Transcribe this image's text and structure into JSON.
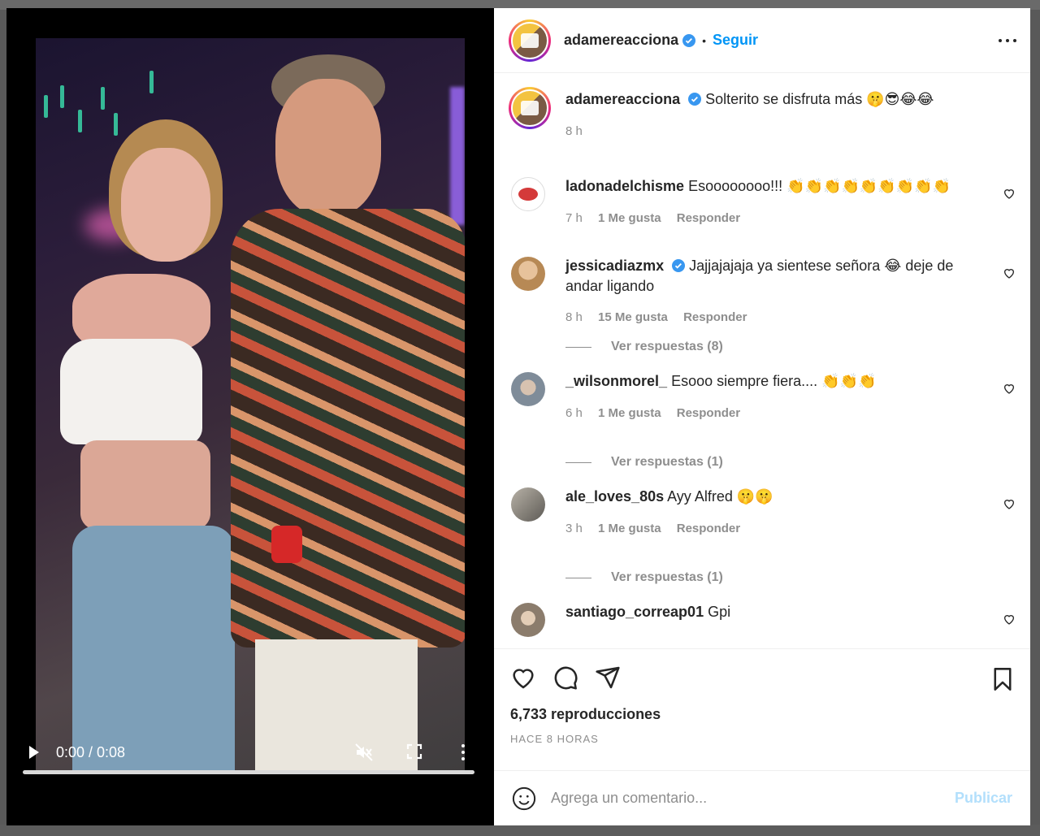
{
  "post": {
    "username": "adamereacciona",
    "follow_label": "Seguir",
    "dot": "•",
    "caption": "Solterito se disfruta más",
    "caption_emojis": "🤫😎😂😂",
    "caption_time": "8 h"
  },
  "video": {
    "time": "0:00 / 0:08",
    "progress_fraction": 0.0
  },
  "comments": [
    {
      "username": "ladonadelchisme",
      "text": "Esoooooooo!!!",
      "emojis": "👏👏👏👏👏👏👏👏👏",
      "time": "7 h",
      "likes": "1 Me gusta",
      "reply_label": "Responder",
      "avatar_color": "#ffffff"
    },
    {
      "username": "jessicadiazmx",
      "verified": true,
      "text": "Jajjajajaja ya sientese señora",
      "emoji_mid": "😂",
      "text_end": "deje de andar ligando",
      "time": "8 h",
      "likes": "15 Me gusta",
      "reply_label": "Responder",
      "replies_label": "Ver respuestas (8)",
      "avatar_color": "#c49a6c"
    },
    {
      "username": "_wilsonmorel_",
      "text": "Esooo siempre fiera....",
      "emojis": "👏👏👏",
      "time": "6 h",
      "likes": "1 Me gusta",
      "reply_label": "Responder",
      "replies_label": "Ver respuestas (1)",
      "avatar_color": "#6b7d8c"
    },
    {
      "username": "ale_loves_80s",
      "text": "Ayy Alfred",
      "emojis": "🤫🤫",
      "time": "3 h",
      "likes": "1 Me gusta",
      "reply_label": "Responder",
      "replies_label": "Ver respuestas (1)",
      "avatar_color": "#8d8a84"
    },
    {
      "username": "santiago_correap01",
      "text": "Gpi",
      "avatar_color": "#9b8d7e"
    }
  ],
  "actions": {
    "views": "6,733 reproducciones",
    "ago": "HACE 8 HORAS"
  },
  "add_comment": {
    "placeholder": "Agrega un comentario...",
    "publish_label": "Publicar"
  },
  "colors": {
    "accent": "#0095f6",
    "verified": "#3897f0",
    "publish_disabled": "#b2dffc",
    "meta_gray": "#8e8e8e"
  }
}
